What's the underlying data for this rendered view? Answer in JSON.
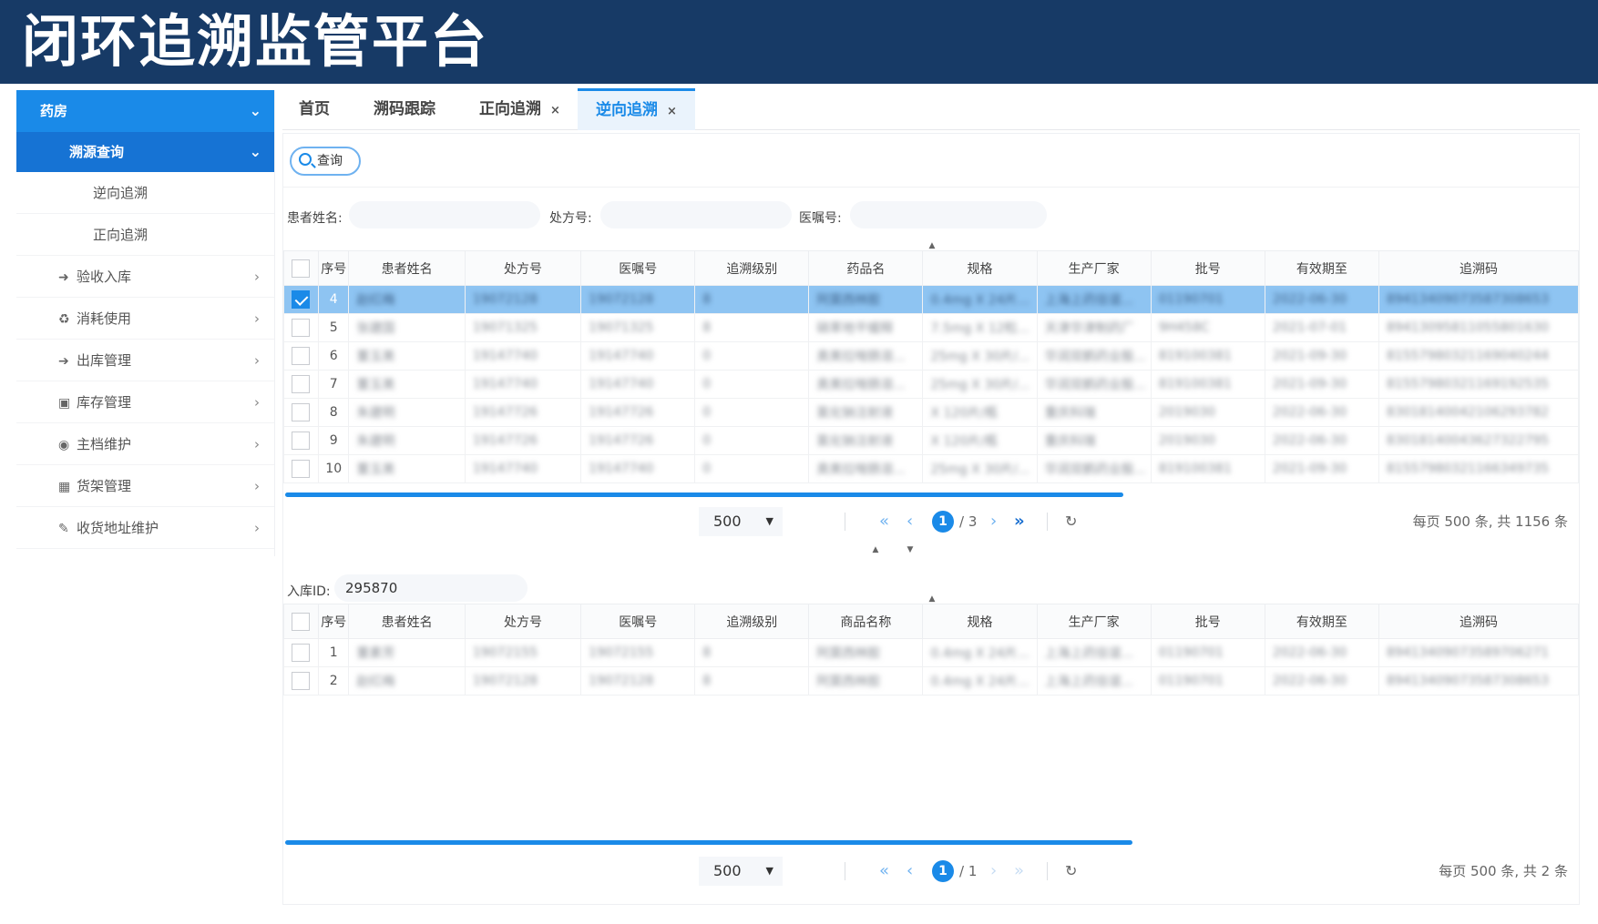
{
  "banner": {
    "title": "闭环追溯监管平台"
  },
  "sidebar": {
    "top": "药房",
    "sub": "溯源查询",
    "children": [
      "逆向追溯",
      "正向追溯"
    ],
    "items": [
      {
        "icon": "➜",
        "label": "验收入库"
      },
      {
        "icon": "♻",
        "label": "消耗使用"
      },
      {
        "icon": "➔",
        "label": "出库管理"
      },
      {
        "icon": "▣",
        "label": "库存管理"
      },
      {
        "icon": "◉",
        "label": "主档维护"
      },
      {
        "icon": "▦",
        "label": "货架管理"
      },
      {
        "icon": "✎",
        "label": "收货地址维护"
      }
    ]
  },
  "tabs": [
    {
      "label": "首页",
      "closable": ""
    },
    {
      "label": "溯码跟踪",
      "closable": ""
    },
    {
      "label": "正向追溯",
      "closable": "×"
    },
    {
      "label": "逆向追溯",
      "closable": "×"
    }
  ],
  "query": {
    "button": "查询",
    "fields": [
      {
        "label": "患者姓名:",
        "value": ""
      },
      {
        "label": "处方号:",
        "value": ""
      },
      {
        "label": "医嘱号:",
        "value": ""
      }
    ]
  },
  "table1": {
    "headers": [
      "序号",
      "患者姓名",
      "处方号",
      "医嘱号",
      "追溯级别",
      "药品名",
      "规格",
      "生产厂家",
      "批号",
      "有效期至",
      "追溯码"
    ],
    "rows": [
      {
        "idx": "4",
        "cells": [
          "赵红梅",
          "19072128",
          "19072128",
          "8",
          "阿莫西林胶",
          "0.4mg X 24片...",
          "上海上药信谊...",
          "01190701",
          "2022-06-30",
          "89413409073587308653"
        ]
      },
      {
        "idx": "5",
        "cells": [
          "张建国",
          "19071325",
          "19071325",
          "8",
          "硝苯地平缓释",
          "7.5mg X 12粒...",
          "天津华津制药厂",
          "9H458C",
          "2021-07-01",
          "89413095811055801630"
        ]
      },
      {
        "idx": "6",
        "cells": [
          "董玉美",
          "19147740",
          "19147740",
          "0",
          "奥美拉唑肠溶...",
          "25mg X 30片/...",
          "华润双鹤药业股...",
          "819100381",
          "2021-09-30",
          "81557980321169040244"
        ]
      },
      {
        "idx": "7",
        "cells": [
          "董玉美",
          "19147740",
          "19147740",
          "0",
          "奥美拉唑肠溶...",
          "25mg X 30片/...",
          "华润双鹤药业股...",
          "819100381",
          "2021-09-30",
          "81557980321169192535"
        ]
      },
      {
        "idx": "8",
        "cells": [
          "朱建明",
          "19147726",
          "19147726",
          "0",
          "氯化钠注射液",
          "X 120片/瓶",
          "重庆科瑞",
          "2019030",
          "2022-06-30",
          "83018140042106293782"
        ]
      },
      {
        "idx": "9",
        "cells": [
          "朱建明",
          "19147726",
          "19147726",
          "0",
          "氯化钠注射液",
          "X 120片/瓶",
          "重庆科瑞",
          "2019030",
          "2022-06-30",
          "83018140043627322795"
        ]
      },
      {
        "idx": "10",
        "cells": [
          "董玉美",
          "19147740",
          "19147740",
          "0",
          "奥美拉唑肠溶...",
          "25mg X 30片/...",
          "华润双鹤药业股...",
          "819100381",
          "2021-09-30",
          "81557980321166349735"
        ]
      }
    ]
  },
  "pager1": {
    "size": "500",
    "page": "1",
    "total": "/ 3",
    "info": "每页 500 条, 共 1156 条"
  },
  "detail": {
    "label": "入库ID:",
    "value": "295870"
  },
  "table2": {
    "headers": [
      "序号",
      "患者姓名",
      "处方号",
      "医嘱号",
      "追溯级别",
      "商品名称",
      "规格",
      "生产厂家",
      "批号",
      "有效期至",
      "追溯码"
    ],
    "rows": [
      {
        "idx": "1",
        "cells": [
          "董素芳",
          "19072155",
          "19072155",
          "8",
          "阿莫西林胶",
          "0.4mg X 24片...",
          "上海上药信谊...",
          "01190701",
          "2022-06-30",
          "89413409073589706271"
        ]
      },
      {
        "idx": "2",
        "cells": [
          "赵红梅",
          "19072128",
          "19072128",
          "8",
          "阿莫西林胶",
          "0.4mg X 24片...",
          "上海上药信谊...",
          "01190701",
          "2022-06-30",
          "89413409073587308653"
        ]
      }
    ]
  },
  "pager2": {
    "size": "500",
    "page": "1",
    "total": "/ 1",
    "info": "每页 500 条, 共 2 条"
  },
  "colors": {
    "banner": "#173a66",
    "accent": "#1a8ae8",
    "selected_row": "#8ec4f2"
  }
}
